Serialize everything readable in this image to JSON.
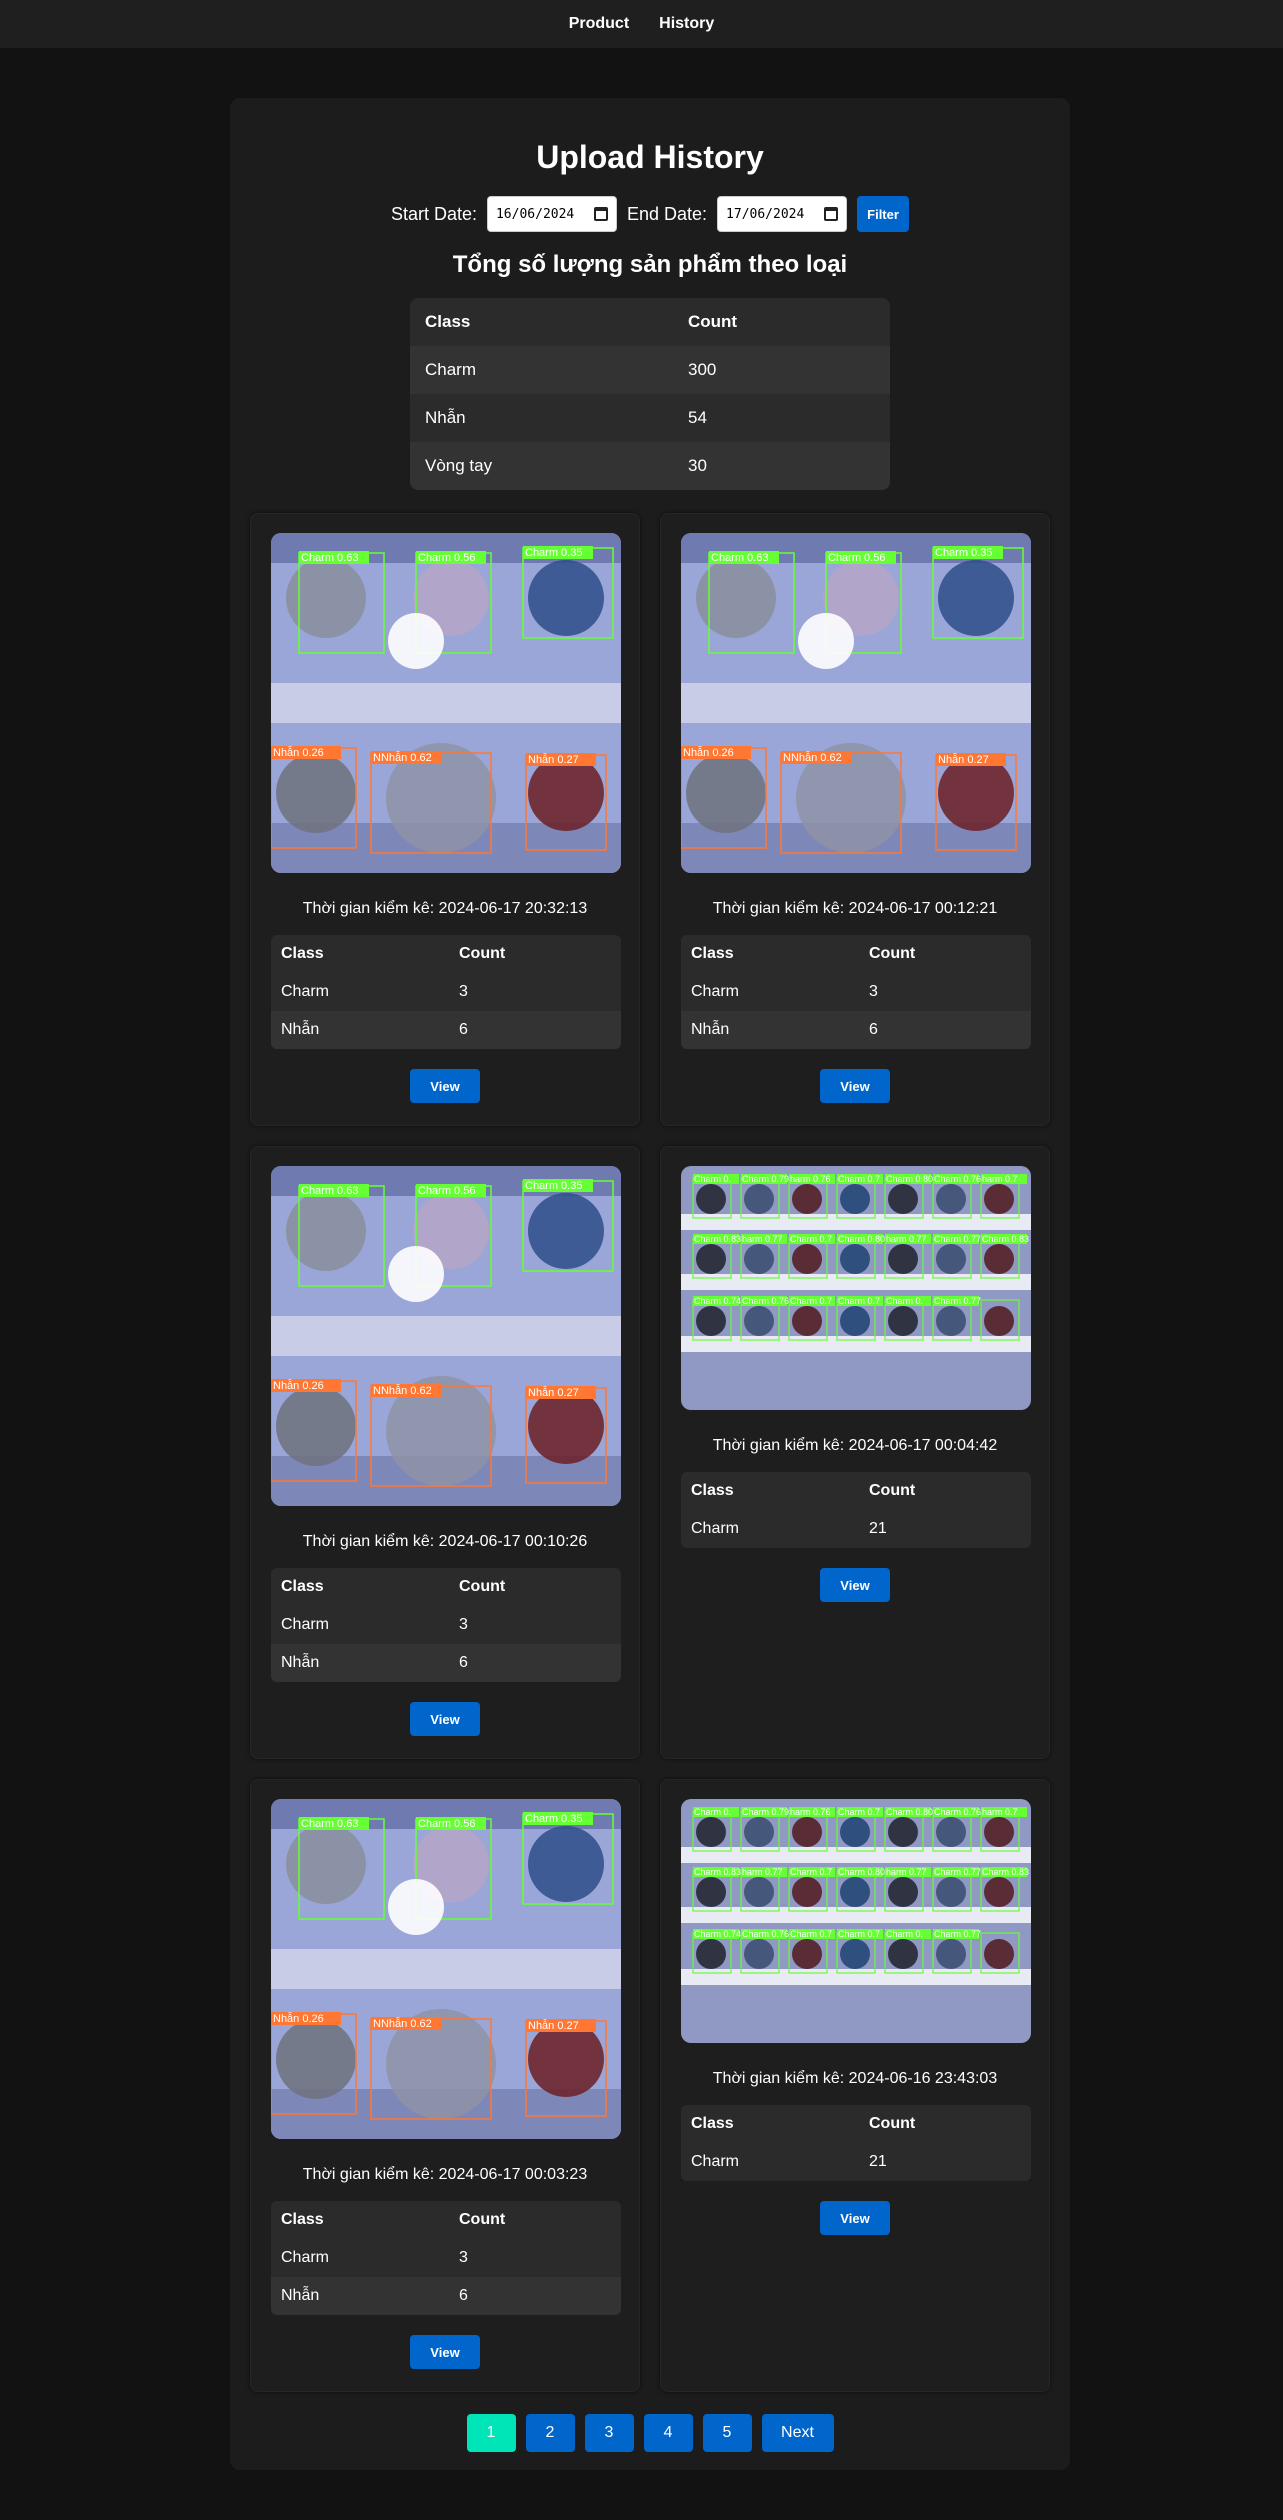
{
  "nav": {
    "product": "Product",
    "history": "History"
  },
  "title": "Upload History",
  "filter": {
    "start_label": "Start Date:",
    "start_value": "16/06/2024",
    "end_label": "End Date:",
    "end_value": "17/06/2024",
    "button": "Filter"
  },
  "summary": {
    "title": "Tổng số lượng sản phẩm theo loại",
    "headers": [
      "Class",
      "Count"
    ],
    "rows": [
      [
        "Charm",
        "300"
      ],
      [
        "Nhẫn",
        "54"
      ],
      [
        "Vòng tay",
        "30"
      ]
    ]
  },
  "cards": [
    {
      "time": "Thời gian kiểm kê: 2024-06-17 20:32:13",
      "rows": [
        [
          "Charm",
          "3"
        ],
        [
          "Nhẫn",
          "6"
        ]
      ],
      "view": "View"
    },
    {
      "time": "Thời gian kiểm kê: 2024-06-17 00:12:21",
      "rows": [
        [
          "Charm",
          "3"
        ],
        [
          "Nhẫn",
          "6"
        ]
      ],
      "view": "View"
    },
    {
      "time": "Thời gian kiểm kê: 2024-06-17 00:10:26",
      "rows": [
        [
          "Charm",
          "3"
        ],
        [
          "Nhẫn",
          "6"
        ]
      ],
      "view": "View"
    },
    {
      "time": "Thời gian kiểm kê: 2024-06-17 00:04:42",
      "rows": [
        [
          "Charm",
          "21"
        ]
      ],
      "view": "View"
    },
    {
      "time": "Thời gian kiểm kê: 2024-06-17 00:03:23",
      "rows": [
        [
          "Charm",
          "3"
        ],
        [
          "Nhẫn",
          "6"
        ]
      ],
      "view": "View"
    },
    {
      "time": "Thời gian kiểm kê: 2024-06-16 23:43:03",
      "rows": [
        [
          "Charm",
          "21"
        ]
      ],
      "view": "View"
    }
  ],
  "table_headers": [
    "Class",
    "Count"
  ],
  "image_labels": {
    "a": [
      "Charm 0.63",
      "Charm 0.56",
      "Charm 0.35",
      "Nhẫn 0.26",
      "NNhẫn 0.62",
      "Nhẫn 0.27"
    ],
    "b": [
      "Charm 0.",
      "Charm 0.79",
      "harm 0.76",
      "Charm 0.7",
      "Charm 0.80",
      "Charm 0.76",
      "harm 0.7",
      "Charm 0.83",
      "harm 0.77",
      "Charm 0.7",
      "Charm 0.80",
      "harm 0.77",
      "Charm 0.77",
      "Charm 0.83",
      "Charm 0.74",
      "Charm 0.76",
      "Charm 0.7",
      "Charm 0.7",
      "Charm 0.",
      "Charm 0.77"
    ]
  },
  "pagination": {
    "pages": [
      "1",
      "2",
      "3",
      "4",
      "5"
    ],
    "next": "Next",
    "active": "1"
  },
  "colors": {
    "accent": "#0066cc",
    "active_page": "#00e5b8",
    "box_green": "#66ff33",
    "box_orange": "#ff7733"
  }
}
